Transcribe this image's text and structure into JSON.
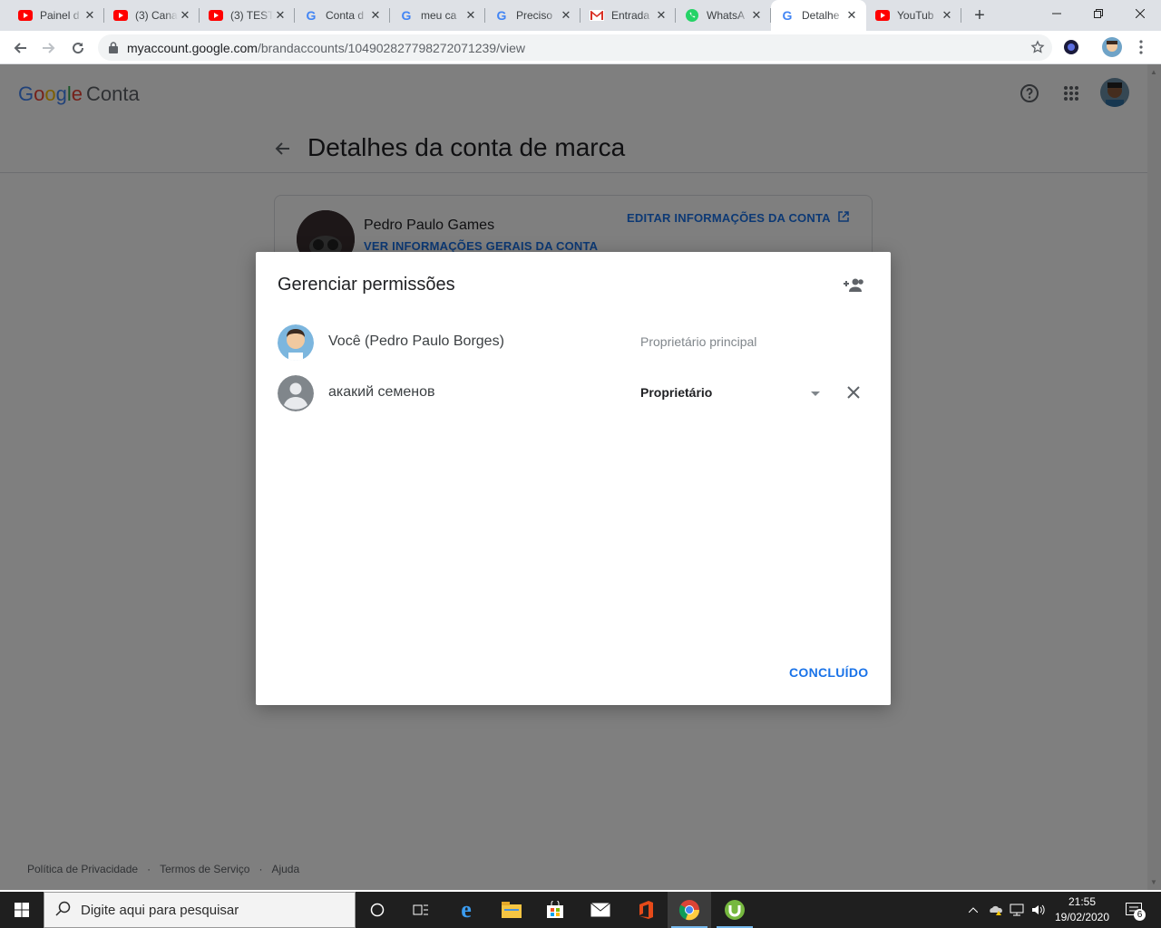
{
  "browser": {
    "tabs": [
      {
        "title": "Painel d",
        "icon": "youtube-icon"
      },
      {
        "title": "(3) Cana",
        "icon": "youtube-icon"
      },
      {
        "title": "(3) TEST",
        "icon": "youtube-icon"
      },
      {
        "title": "Conta d",
        "icon": "google-icon"
      },
      {
        "title": "meu ca",
        "icon": "google-icon"
      },
      {
        "title": "Preciso",
        "icon": "google-icon"
      },
      {
        "title": "Entrada",
        "icon": "gmail-icon"
      },
      {
        "title": "WhatsA",
        "icon": "whatsapp-icon"
      },
      {
        "title": "Detalhe",
        "icon": "google-icon",
        "active": true
      },
      {
        "title": "YouTub",
        "icon": "youtube-icon"
      }
    ],
    "url_host": "myaccount.google.com",
    "url_path": "/brandaccounts/104902827798272071239/view"
  },
  "header": {
    "logo": "Google",
    "product": "Conta"
  },
  "page": {
    "title": "Detalhes da conta de marca",
    "account_name": "Pedro Paulo Games",
    "view_info_link": "VER INFORMAÇÕES GERAIS DA CONTA",
    "edit_info_link": "EDITAR INFORMAÇÕES DA CONTA"
  },
  "dialog": {
    "title": "Gerenciar permissões",
    "members": [
      {
        "name": "Você (Pedro Paulo Borges)",
        "role": "Proprietário principal"
      },
      {
        "name": "акакий семенов",
        "role": "Proprietário"
      }
    ],
    "done_label": "CONCLUÍDO"
  },
  "footer": {
    "privacy": "Política de Privacidade",
    "terms": "Termos de Serviço",
    "help": "Ajuda"
  },
  "taskbar": {
    "search_placeholder": "Digite aqui para pesquisar",
    "time": "21:55",
    "date": "19/02/2020",
    "notification_count": "6"
  },
  "colors": {
    "accent": "#1a73e8",
    "overlay": "#000000"
  }
}
